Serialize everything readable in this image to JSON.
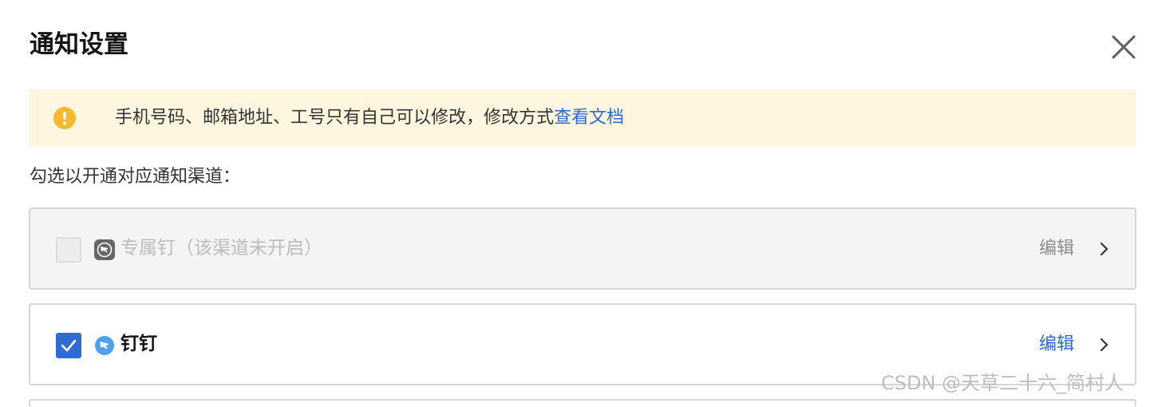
{
  "dialog": {
    "title": "通知设置",
    "close_icon": "close-icon"
  },
  "notice": {
    "icon": "warning-icon",
    "icon_color": "#f6b930",
    "background": "#fff6df",
    "message": "手机号码、邮箱地址、工号只有自己可以修改，修改方式",
    "link": "查看文档",
    "link_color": "#2a6ad3"
  },
  "subtitle": "勾选以开通对应通知渠道：",
  "channels": [
    {
      "label": "专属钉（该渠道未开启）",
      "checked": false,
      "disabled": true,
      "icon": "exclusive-ding-icon",
      "edit": "编辑"
    },
    {
      "label": "钉钉",
      "checked": true,
      "disabled": false,
      "icon": "dingtalk-icon",
      "edit": "编辑",
      "accent": "#2e6bd2"
    }
  ],
  "watermark": "CSDN @天草二十六_简村人"
}
